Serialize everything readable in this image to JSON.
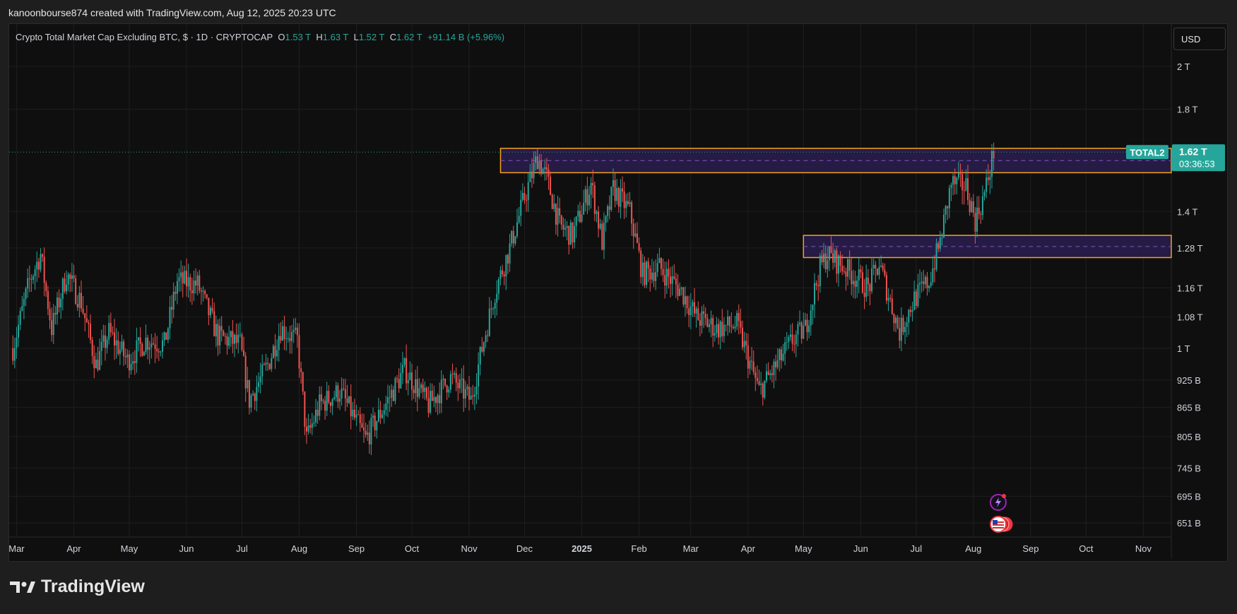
{
  "header": {
    "attribution": "kanoonbourse874 created with TradingView.com, Aug 12, 2025 20:23 UTC"
  },
  "legend": {
    "title": "Crypto Total Market Cap Excluding BTC, $ · 1D · CRYPTOCAP",
    "o_label": "O",
    "o_value": "1.53 T",
    "h_label": "H",
    "h_value": "1.63 T",
    "l_label": "L",
    "l_value": "1.52 T",
    "c_label": "C",
    "c_value": "1.62 T",
    "change": "+91.14 B (+5.96%)"
  },
  "toolbar": {
    "currency_label": "USD"
  },
  "logo": {
    "text": "TradingView"
  },
  "price_tag": {
    "symbol": "TOTAL2",
    "price": "1.62 T",
    "countdown": "03:36:53"
  },
  "colors": {
    "up": "#26a69a",
    "down": "#ef5350",
    "zone_border": "#f7a21b",
    "zone_fill": "#2a1d4e",
    "background": "#0f0f0f",
    "grid": "#1f1f1f"
  },
  "icons": [
    "lightning-event-icon",
    "us-flag-event-icon"
  ],
  "chart_data": {
    "type": "candlestick",
    "title": "Crypto Total Market Cap Excluding BTC, $ · 1D · CRYPTOCAP",
    "scale": "log",
    "ylim": [
      "620 B",
      "2.15 T"
    ],
    "y_ticks": [
      {
        "label": "2 T",
        "value": 2000
      },
      {
        "label": "1.8 T",
        "value": 1800
      },
      {
        "label": "1.4 T",
        "value": 1400
      },
      {
        "label": "1.28 T",
        "value": 1280
      },
      {
        "label": "1.16 T",
        "value": 1160
      },
      {
        "label": "1.08 T",
        "value": 1080
      },
      {
        "label": "1 T",
        "value": 1000
      },
      {
        "label": "925 B",
        "value": 925
      },
      {
        "label": "865 B",
        "value": 865
      },
      {
        "label": "805 B",
        "value": 805
      },
      {
        "label": "745 B",
        "value": 745
      },
      {
        "label": "695 B",
        "value": 695
      },
      {
        "label": "651 B",
        "value": 651
      }
    ],
    "x_ticks": [
      {
        "label": "Mar",
        "date": "2024-03-01"
      },
      {
        "label": "Apr",
        "date": "2024-04-01"
      },
      {
        "label": "May",
        "date": "2024-05-01"
      },
      {
        "label": "Jun",
        "date": "2024-06-01"
      },
      {
        "label": "Jul",
        "date": "2024-07-01"
      },
      {
        "label": "Aug",
        "date": "2024-08-01"
      },
      {
        "label": "Sep",
        "date": "2024-09-01"
      },
      {
        "label": "Oct",
        "date": "2024-10-01"
      },
      {
        "label": "Nov",
        "date": "2024-11-01"
      },
      {
        "label": "Dec",
        "date": "2024-12-01"
      },
      {
        "label": "2025",
        "date": "2025-01-01",
        "bold": true
      },
      {
        "label": "Feb",
        "date": "2025-02-01"
      },
      {
        "label": "Mar",
        "date": "2025-03-01"
      },
      {
        "label": "Apr",
        "date": "2025-04-01"
      },
      {
        "label": "May",
        "date": "2025-05-01"
      },
      {
        "label": "Jun",
        "date": "2025-06-01"
      },
      {
        "label": "Jul",
        "date": "2025-07-01"
      },
      {
        "label": "Aug",
        "date": "2025-08-01"
      },
      {
        "label": "Sep",
        "date": "2025-09-01"
      },
      {
        "label": "Oct",
        "date": "2025-10-01"
      },
      {
        "label": "Nov",
        "date": "2025-11-01"
      }
    ],
    "zones": [
      {
        "name": "resistance-zone",
        "start": "2024-11-18",
        "top": 1635,
        "bottom": 1540
      },
      {
        "name": "support-zone",
        "start": "2025-05-01",
        "top": 1320,
        "bottom": 1250
      }
    ],
    "last_close": 1620,
    "last_date": "2025-08-12",
    "close_series": [
      {
        "date": "2024-02-28",
        "close": 1000
      },
      {
        "date": "2024-03-08",
        "close": 1180
      },
      {
        "date": "2024-03-14",
        "close": 1260
      },
      {
        "date": "2024-03-20",
        "close": 1050
      },
      {
        "date": "2024-03-28",
        "close": 1200
      },
      {
        "date": "2024-04-05",
        "close": 1120
      },
      {
        "date": "2024-04-13",
        "close": 960
      },
      {
        "date": "2024-04-20",
        "close": 1040
      },
      {
        "date": "2024-04-30",
        "close": 970
      },
      {
        "date": "2024-05-10",
        "close": 1020
      },
      {
        "date": "2024-05-20",
        "close": 1010
      },
      {
        "date": "2024-05-27",
        "close": 1180
      },
      {
        "date": "2024-06-07",
        "close": 1170
      },
      {
        "date": "2024-06-18",
        "close": 1030
      },
      {
        "date": "2024-06-30",
        "close": 1010
      },
      {
        "date": "2024-07-05",
        "close": 880
      },
      {
        "date": "2024-07-15",
        "close": 960
      },
      {
        "date": "2024-07-22",
        "close": 1050
      },
      {
        "date": "2024-07-31",
        "close": 1020
      },
      {
        "date": "2024-08-05",
        "close": 800
      },
      {
        "date": "2024-08-12",
        "close": 870
      },
      {
        "date": "2024-08-23",
        "close": 900
      },
      {
        "date": "2024-09-06",
        "close": 800
      },
      {
        "date": "2024-09-18",
        "close": 880
      },
      {
        "date": "2024-09-27",
        "close": 950
      },
      {
        "date": "2024-10-10",
        "close": 870
      },
      {
        "date": "2024-10-22",
        "close": 930
      },
      {
        "date": "2024-11-02",
        "close": 880
      },
      {
        "date": "2024-11-08",
        "close": 1000
      },
      {
        "date": "2024-11-15",
        "close": 1150
      },
      {
        "date": "2024-11-23",
        "close": 1280
      },
      {
        "date": "2024-12-01",
        "close": 1450
      },
      {
        "date": "2024-12-08",
        "close": 1600
      },
      {
        "date": "2024-12-13",
        "close": 1520
      },
      {
        "date": "2024-12-20",
        "close": 1350
      },
      {
        "date": "2024-12-27",
        "close": 1320
      },
      {
        "date": "2025-01-06",
        "close": 1500
      },
      {
        "date": "2025-01-12",
        "close": 1300
      },
      {
        "date": "2025-01-18",
        "close": 1480
      },
      {
        "date": "2025-01-27",
        "close": 1400
      },
      {
        "date": "2025-02-03",
        "close": 1200
      },
      {
        "date": "2025-02-12",
        "close": 1220
      },
      {
        "date": "2025-02-24",
        "close": 1150
      },
      {
        "date": "2025-03-04",
        "close": 1080
      },
      {
        "date": "2025-03-15",
        "close": 1050
      },
      {
        "date": "2025-03-26",
        "close": 1060
      },
      {
        "date": "2025-04-07",
        "close": 900
      },
      {
        "date": "2025-04-15",
        "close": 950
      },
      {
        "date": "2025-04-25",
        "close": 1020
      },
      {
        "date": "2025-05-02",
        "close": 1050
      },
      {
        "date": "2025-05-10",
        "close": 1220
      },
      {
        "date": "2025-05-14",
        "close": 1260
      },
      {
        "date": "2025-05-25",
        "close": 1210
      },
      {
        "date": "2025-06-05",
        "close": 1160
      },
      {
        "date": "2025-06-11",
        "close": 1230
      },
      {
        "date": "2025-06-22",
        "close": 1040
      },
      {
        "date": "2025-06-30",
        "close": 1130
      },
      {
        "date": "2025-07-08",
        "close": 1180
      },
      {
        "date": "2025-07-14",
        "close": 1300
      },
      {
        "date": "2025-07-20",
        "close": 1500
      },
      {
        "date": "2025-07-28",
        "close": 1490
      },
      {
        "date": "2025-08-02",
        "close": 1370
      },
      {
        "date": "2025-08-07",
        "close": 1460
      },
      {
        "date": "2025-08-12",
        "close": 1620
      }
    ]
  }
}
